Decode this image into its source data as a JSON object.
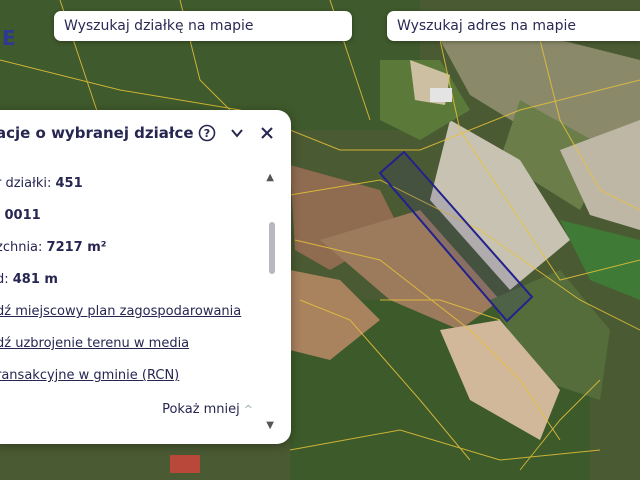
{
  "search_parcel": {
    "placeholder": "Wyszukaj działkę na mapie"
  },
  "search_address": {
    "placeholder": "Wyszukaj adres na mapie"
  },
  "map": {
    "edge_letter": "E",
    "parcel_outline_color": "#22228c"
  },
  "panel": {
    "title": "acje o wybranej działce",
    "rows": [
      {
        "label": "r działki: ",
        "value": "451"
      },
      {
        "label": ": ",
        "value": "0011"
      },
      {
        "label": "zchnia: ",
        "value": "7217 m²"
      },
      {
        "label": "d: ",
        "value": "481 m"
      }
    ],
    "links": [
      "dź miejscowy plan zagospodarowania",
      "dź uzbrojenie terenu w media",
      "ransakcyjne w gminie (RCN)"
    ],
    "show_less": "Pokaż mniej",
    "icons": [
      "help-icon",
      "chevron-down-icon",
      "close-icon"
    ]
  }
}
